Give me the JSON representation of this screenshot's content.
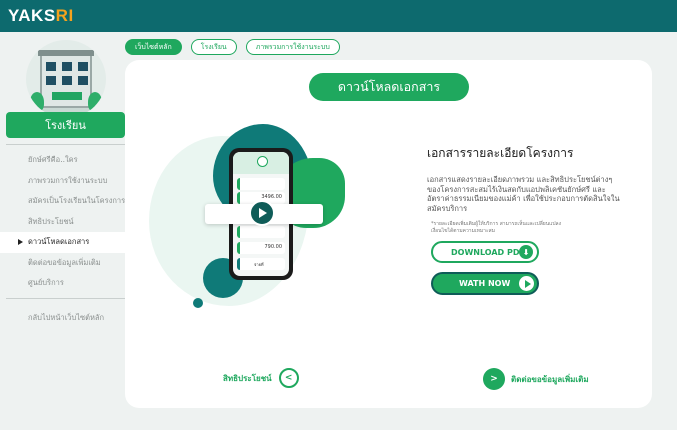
{
  "app": {
    "logo_main": "YAKS",
    "logo_accent": "RI"
  },
  "sidebar": {
    "title": "โรงเรียน",
    "items": [
      {
        "label": "ยักษ์ศรีคือ..ใคร"
      },
      {
        "label": "ภาพรวมการใช้งานระบบ"
      },
      {
        "label": "สมัครเป็นโรงเรียนในโครงการ"
      },
      {
        "label": "สิทธิประโยชน์"
      },
      {
        "label": "ดาวน์โหลดเอกสาร"
      },
      {
        "label": "ติดต่อขอข้อมูลเพิ่มเติม"
      },
      {
        "label": "ศูนย์บริการ"
      }
    ],
    "active_index": 4,
    "back_label": "กลับไปหน้าเว็บไซต์หลัก"
  },
  "breadcrumb": {
    "items": [
      "เว็บไซต์หลัก",
      "โรงเรียน",
      "ภาพรวมการใช้งานระบบ"
    ]
  },
  "main": {
    "title": "ดาวน์โหลดเอกสาร",
    "info_title": "เอกสารรายละเอียดโครงการ",
    "info_desc": "เอกสารแสดงรายละเอียดภาพรวม และสิทธิประโยชน์ต่างๆ ของโครงการสะสมไร้เงินสดกับแอปพลิเคชันยักษ์ศรี และอัตราค่าธรรมเนียมของแม่ค้า เพื่อใช้ประกอบการตัดสินใจในสมัครบริการ",
    "info_note": "*รายละเอียดเพิ่มเติมผู้ให้บริการ สามารถเห็นและเปลี่ยนแปลงเงื่อนไขได้ตามความเหมาะสม",
    "download_label": "DOWNLOAD PDF",
    "watch_label": "WATH NOW",
    "prev_label": "สิทธิประโยชน์",
    "next_label": "ติดต่อขอข้อมูลเพิ่มเติม"
  },
  "phone_screen": {
    "balance": "3496.00",
    "amount": "790.00",
    "footer": "จ่ายที่"
  },
  "colors": {
    "brand_green": "#1fa85e",
    "topbar_teal": "#0d6a6e",
    "accent_orange": "#f4a21d"
  }
}
